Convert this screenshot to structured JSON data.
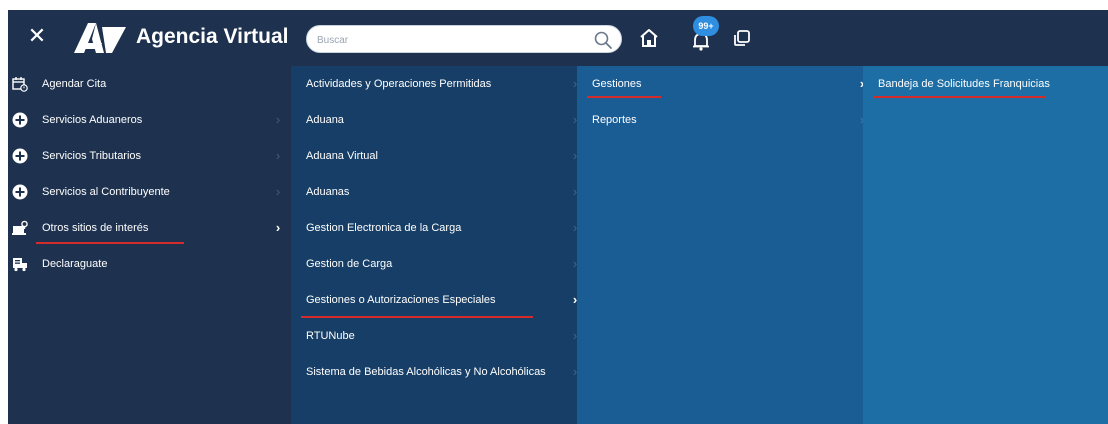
{
  "header": {
    "app_title": "Agencia Virtual",
    "search_placeholder": "Buscar",
    "notification_badge": "99+",
    "colors": {
      "header_bg": "#1e324f",
      "badge": "#2f8ee0",
      "highlight_underline": "#d42b2b"
    },
    "icons": [
      "close-icon",
      "agency-logo",
      "search-icon",
      "home-icon",
      "bell-icon",
      "windows-icon"
    ]
  },
  "menu": {
    "column1": [
      {
        "label": "Agendar Cita",
        "icon": "calendar-icon"
      },
      {
        "label": "Servicios Aduaneros",
        "icon": "plus-circle-icon"
      },
      {
        "label": "Servicios Tributarios",
        "icon": "plus-circle-icon"
      },
      {
        "label": "Servicios al Contribuyente",
        "icon": "plus-circle-icon"
      },
      {
        "label": "Otros sitios de interés",
        "icon": "links-icon",
        "selected": true
      },
      {
        "label": "Declaraguate",
        "icon": "truck-icon"
      }
    ],
    "column2": [
      {
        "label": "Actividades y Operaciones Permitidas"
      },
      {
        "label": "Aduana"
      },
      {
        "label": "Aduana Virtual"
      },
      {
        "label": "Aduanas"
      },
      {
        "label": "Gestion Electronica de la Carga"
      },
      {
        "label": "Gestion de Carga"
      },
      {
        "label": "Gestiones o Autorizaciones Especiales",
        "selected": true
      },
      {
        "label": "RTUNube"
      },
      {
        "label": "Sistema de Bebidas Alcohólicas y No Alcohólicas"
      }
    ],
    "column3": [
      {
        "label": "Gestiones",
        "selected": true
      },
      {
        "label": "Reportes"
      }
    ],
    "column4": [
      {
        "label": "Bandeja de Solicitudes Franquicias",
        "selected": true
      }
    ]
  }
}
